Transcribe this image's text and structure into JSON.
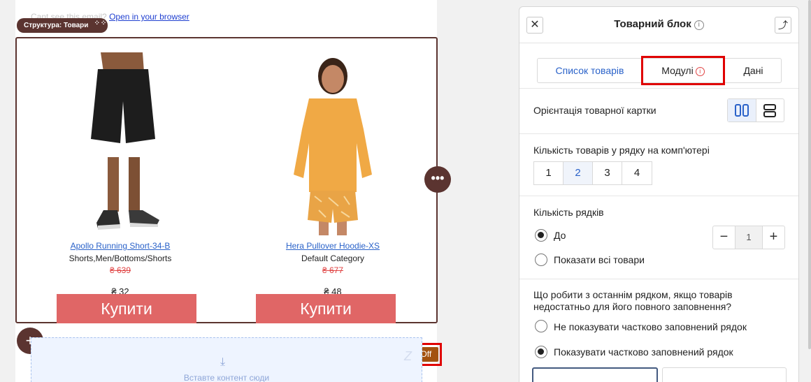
{
  "preheader": {
    "text": "Cant see this email?",
    "link": "Open in your browser"
  },
  "structure_label": "Структура: Товари",
  "products": [
    {
      "name": "Apollo Running Short-34-B",
      "category": "Shorts,Men/Bottoms/Shorts",
      "old_price": "₴ 639",
      "price": "₴ 32",
      "buy_label": "Купити"
    },
    {
      "name": "Hera Pullover Hoodie-XS",
      "category": "Default Category",
      "old_price": "₴ 677",
      "price": "₴ 48",
      "buy_label": "Купити"
    }
  ],
  "off_button": "Off",
  "dropzone_text": "Вставте контент сюди",
  "panel": {
    "title": "Товарний блок",
    "tabs": [
      {
        "label": "Список товарів"
      },
      {
        "label": "Модулі"
      },
      {
        "label": "Дані"
      }
    ],
    "orientation_label": "Орієнтація товарної картки",
    "per_row_label": "Кількість товарів у рядку на комп'ютері",
    "per_row_options": [
      "1",
      "2",
      "3",
      "4"
    ],
    "rows_label": "Кількість рядків",
    "rows_option_up_to": "До",
    "rows_option_all": "Показати всі товари",
    "rows_value": "1",
    "last_row_question": "Що робити з останнім рядком, якщо товарів недостатньо для його повного заповнення?",
    "last_row_option_hide": "Не показувати частково заповнений рядок",
    "last_row_option_show": "Показувати частково заповнений рядок"
  },
  "colors": {
    "accent_brown": "#5b3430",
    "buy_button": "#e06666",
    "link_blue": "#2a62c9",
    "highlight_red": "#e00000"
  }
}
